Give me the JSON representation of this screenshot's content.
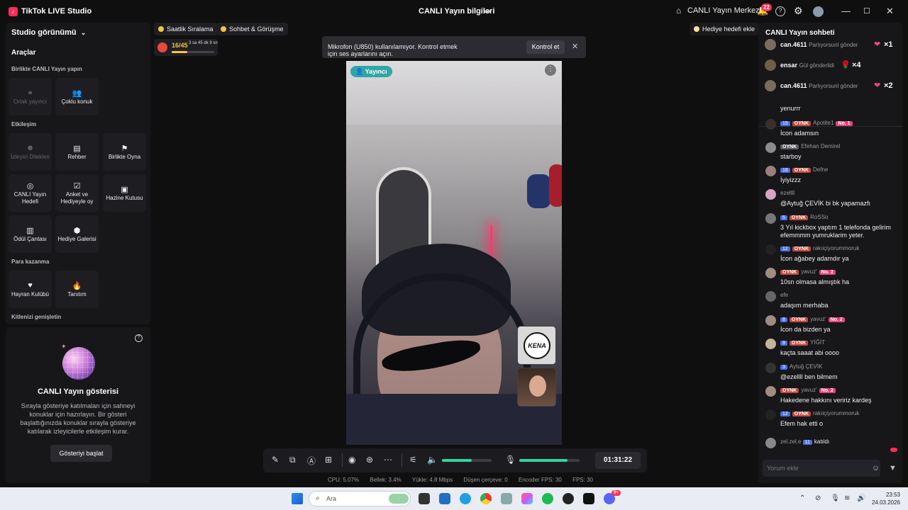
{
  "window": {
    "app_title": "TikTok LIVE Studio",
    "center_title": "CANLI Yayın bilgileri",
    "live_center": "CANLI Yayın Merkezi",
    "notif_count": "22"
  },
  "left": {
    "studio_view": "Studio görünümü",
    "tools_title": "Araçlar",
    "section_together": "Birlikte CANLI Yayın yapın",
    "tiles_together": [
      {
        "label": "Ortak yayıncı",
        "icon": "co-host-icon",
        "enabled": false
      },
      {
        "label": "Çoklu konuk",
        "icon": "multi-guest-icon",
        "enabled": true
      }
    ],
    "section_interaction": "Etkileşim",
    "tiles_interaction": [
      {
        "label": "İzleyici Dilekleri",
        "icon": "viewer-wishes-icon",
        "enabled": false
      },
      {
        "label": "Rehber",
        "icon": "guide-icon",
        "enabled": true
      },
      {
        "label": "Birlikte Oyna",
        "icon": "play-together-icon",
        "enabled": true
      },
      {
        "label": "CANLI Yayın Hedefi",
        "icon": "live-goal-icon",
        "enabled": true
      },
      {
        "label": "Anket ve Hediyeyle oy",
        "icon": "poll-icon",
        "enabled": true
      },
      {
        "label": "Hazine Kutusu",
        "icon": "treasure-box-icon",
        "enabled": true
      },
      {
        "label": "Ödül Çantası",
        "icon": "reward-bag-icon",
        "enabled": true
      },
      {
        "label": "Hediye Galerisi",
        "icon": "gift-gallery-icon",
        "enabled": true
      }
    ],
    "section_earn": "Para kazanma",
    "tiles_earn": [
      {
        "label": "Hayran Kulübü",
        "icon": "fan-club-icon",
        "enabled": true
      },
      {
        "label": "Tanıtım",
        "icon": "promote-icon",
        "enabled": true
      }
    ],
    "section_grow": "Kitlenizi genişletin",
    "show": {
      "title": "CANLI Yayın gösterisi",
      "desc": "Sırayla gösteriye katılmaları için sahneyi konuklar için hazırlayın. Bir gösteri başlattığınızda konuklar sırayla gösteriye katılarak izleyicilerle etkileşim kurar.",
      "button": "Gösteriyi başlat"
    }
  },
  "top": {
    "chip_hourly": "Saatlik Sıralama",
    "chip_chat": "Sohbet & Görüşme",
    "goal_count": "16/45",
    "goal_time": "3 sa 45 dk 9 sn",
    "goal_progress": 0.36,
    "gift_goal": "Hediye hedefi ekle"
  },
  "toast": {
    "message": "Mikrofon (U850) kullanılamıyor. Kontrol etmek için ses ayarlarını açın.",
    "button": "Kontrol et"
  },
  "video": {
    "host_badge": "Yayıncı",
    "guest1_logo": "KENA"
  },
  "controls": {
    "speaker_level": 0.6,
    "mic_level": 0.8,
    "timer": "01:31:22"
  },
  "stats": {
    "cpu": "CPU: 5.07%",
    "memory": "Bellek: 3.4%",
    "upload": "Yükle: 4.8 Mbps",
    "dropped": "Düşen çerçeve: 0",
    "encoder_fps": "Encoder FPS: 30",
    "fps": "FPS: 30"
  },
  "chat": {
    "title": "CANLI Yayın sohbeti",
    "pinned": [
      {
        "user": "can.4611",
        "text": "Parlıyorsunl gönder",
        "count": "×1"
      },
      {
        "user": "ensar",
        "text": "Gül gönderildi",
        "count": "×4"
      },
      {
        "user": "can.4611",
        "text": "Parlıyorsunl gönder",
        "count": "×2"
      }
    ],
    "messages": [
      {
        "meta": "",
        "text": "yenurrr"
      },
      {
        "level": "15",
        "fan": "OYNK",
        "user": "Apotite1",
        "rank": "No. 1",
        "text": "İcon adamsın"
      },
      {
        "fan": "OYNK",
        "user": "Efehan Demirel",
        "text": "starboy"
      },
      {
        "level": "18",
        "fan": "OYNK",
        "user": "Defne",
        "text": "İyiyizzz"
      },
      {
        "user": "ezellll",
        "text": "@Aytuğ ÇEVİK bi bk yapamazfı"
      },
      {
        "level": "5",
        "fan": "OYNK",
        "user": "RoSSo",
        "text": "3 Yıl kickbox yaptım 1 telefonda gelirim efemmmm yumruklarim yeter."
      },
      {
        "level": "12",
        "fan": "OYNK",
        "user": "rakıiçiyorummoruk",
        "text": "İcon ağabey adamdır ya"
      },
      {
        "fan": "OYNK",
        "user": "yavuz'",
        "rank": "No. 2",
        "text": "10sn olmasa almıştık ha"
      },
      {
        "user": "efe",
        "text": "adaşım merhaba"
      },
      {
        "level": "8",
        "fan": "OYNK",
        "user": "yavuz'",
        "rank": "No. 2",
        "text": "İcon da bizden ya"
      },
      {
        "level": "9",
        "fan": "OYNK",
        "user": "YİĞİT",
        "text": "kaçta saaat abi oooo"
      },
      {
        "level": "3",
        "user": "Aytuğ ÇEVİK",
        "text": "@ezellll  ben bilmem"
      },
      {
        "fan": "OYNK",
        "user": "yavuz'",
        "rank": "No. 2",
        "text": "Hakedene hakkını veririz kardeş"
      },
      {
        "level": "12",
        "fan": "OYNK",
        "user": "rakıiçiyorummoruk",
        "text": "Efem hak etti o"
      },
      {
        "user": "zel.zel.e",
        "level": "11",
        "text": "katıldı"
      }
    ],
    "input_placeholder": "Yorum ekle"
  },
  "taskbar": {
    "search": "Ara",
    "time": "23:53",
    "date": "24.03.2026",
    "discord_badge": "9+"
  }
}
